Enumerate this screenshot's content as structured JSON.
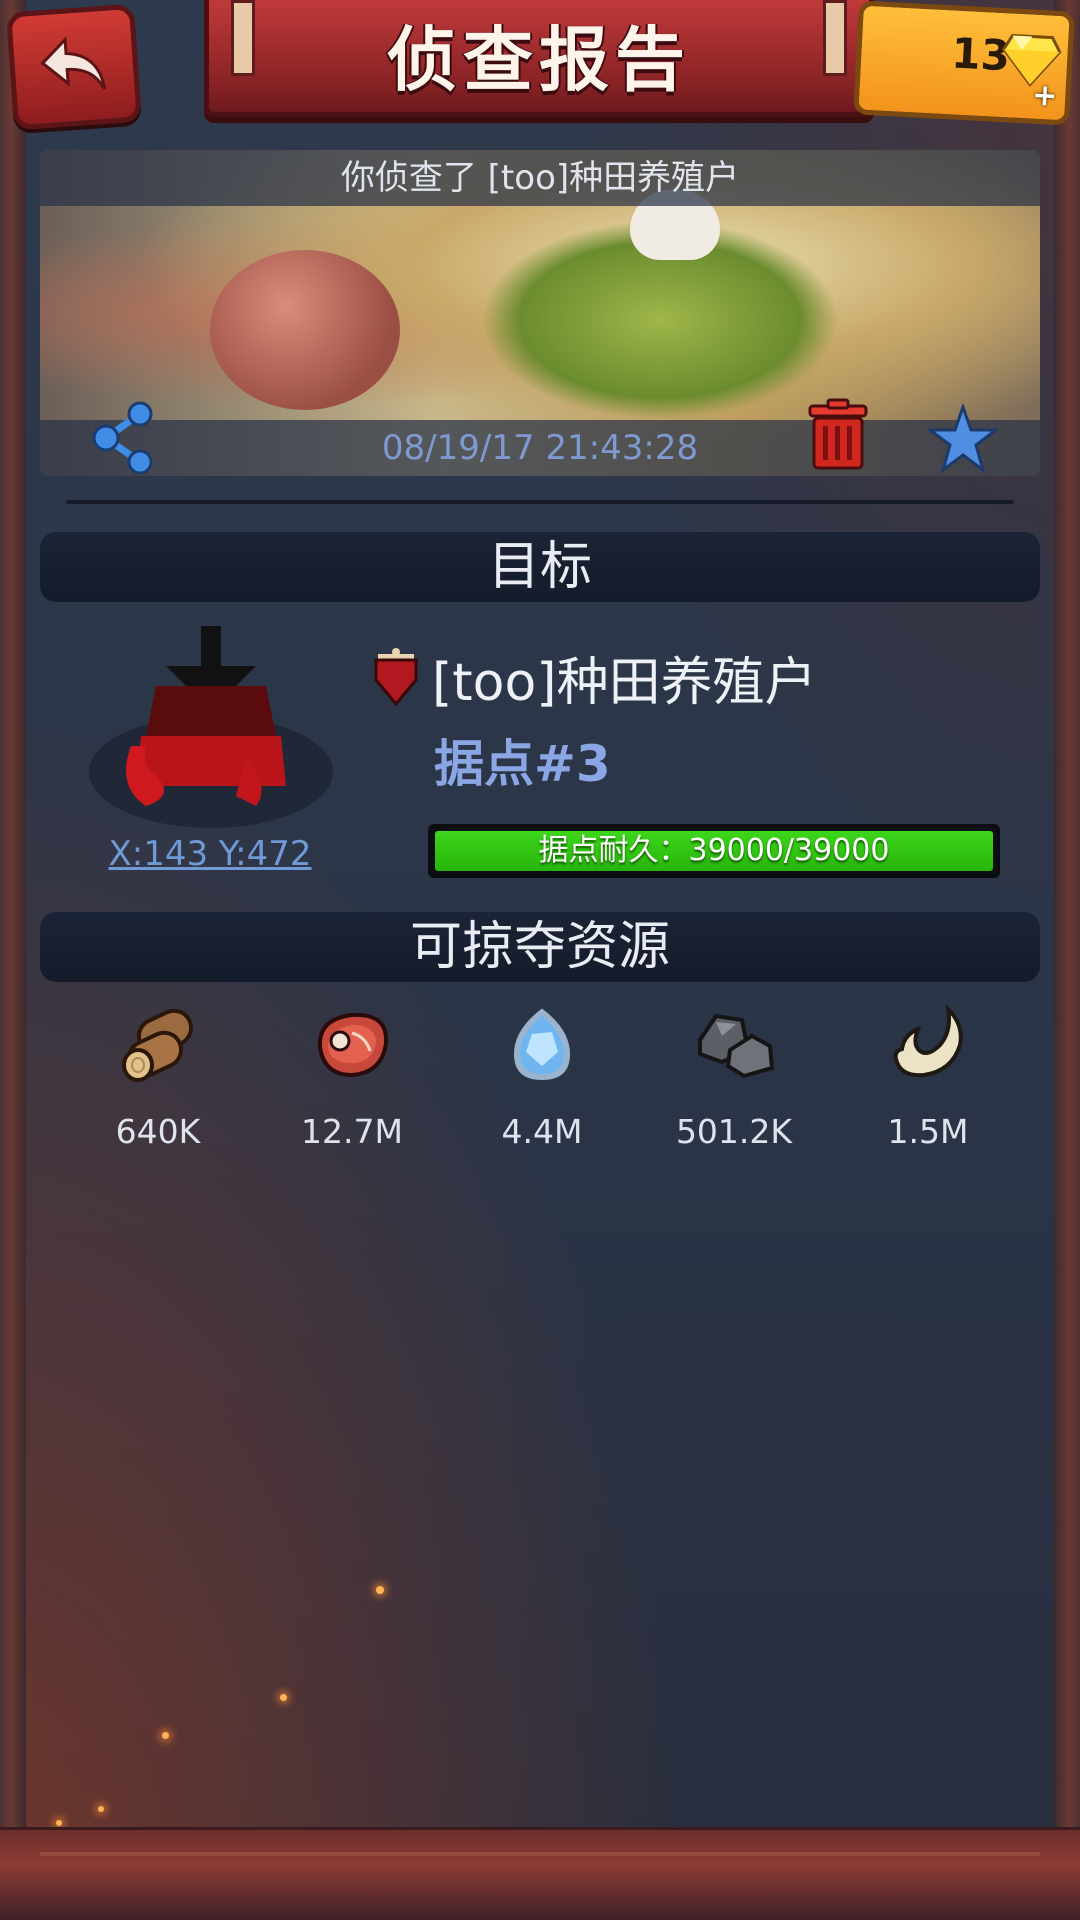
{
  "header": {
    "title": "侦查报告",
    "gems": "13",
    "gem_plus": "+"
  },
  "banner": {
    "caption": "你侦查了 [too]种田养殖户",
    "timestamp": "08/19/17 21:43:28"
  },
  "target": {
    "section_title": "目标",
    "player_name": "[too]种田养殖户",
    "base_name": "据点#3",
    "coords": "X:143 Y:472",
    "durability_label": "据点耐久：39000/39000",
    "durability_ratio": 1.0
  },
  "resources": {
    "section_title": "可掠夺资源",
    "items": [
      {
        "icon": "wood-icon",
        "value": "640K"
      },
      {
        "icon": "meat-icon",
        "value": "12.7M"
      },
      {
        "icon": "crystal-icon",
        "value": "4.4M"
      },
      {
        "icon": "stone-icon",
        "value": "501.2K"
      },
      {
        "icon": "bone-icon",
        "value": "1.5M"
      }
    ]
  },
  "colors": {
    "accent_red": "#b52f31",
    "gold": "#f7a82a",
    "progress_green": "#2fc412",
    "link_blue": "#6f9ad6"
  }
}
